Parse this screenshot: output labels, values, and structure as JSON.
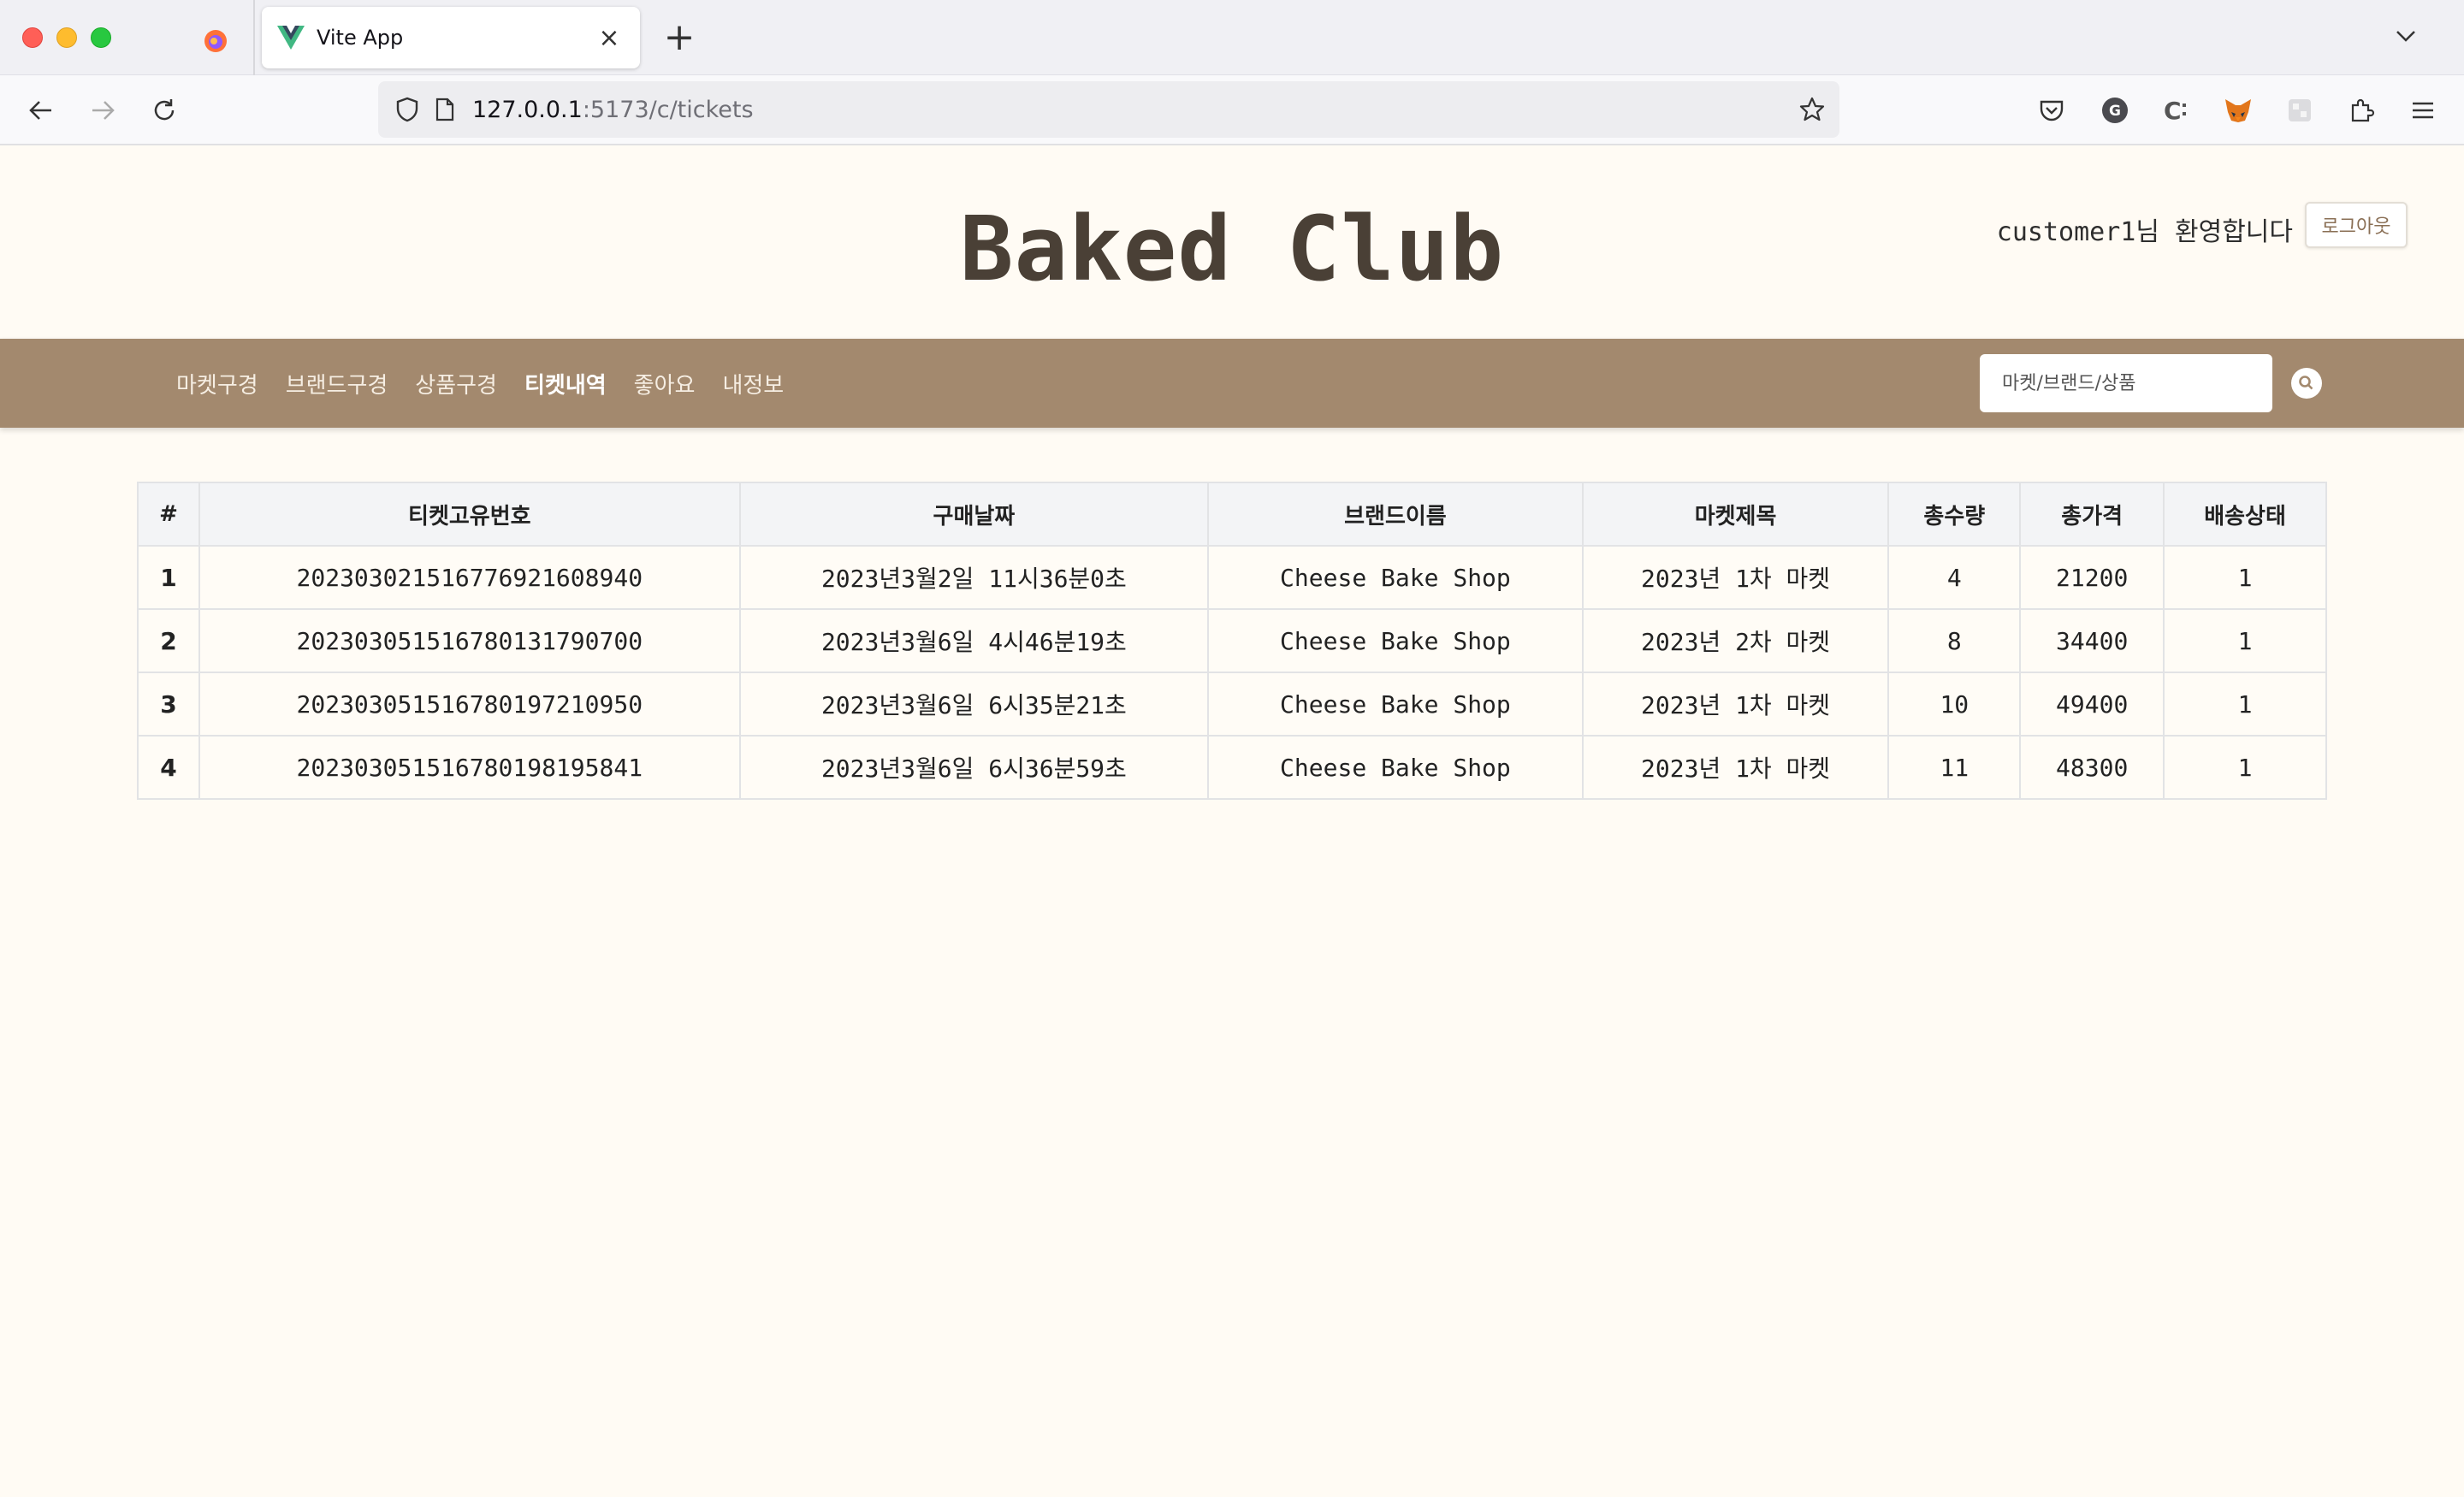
{
  "browser": {
    "tab_title": "Vite App",
    "url_host": "127.0.0.1",
    "url_path": ":5173/c/tickets"
  },
  "site": {
    "title": "Baked Club",
    "greeting": "customer1님 환영합니다",
    "logout_label": "로그아웃"
  },
  "nav": {
    "items": [
      {
        "label": "마켓구경"
      },
      {
        "label": "브랜드구경"
      },
      {
        "label": "상품구경"
      },
      {
        "label": "티켓내역",
        "active": true
      },
      {
        "label": "좋아요"
      },
      {
        "label": "내정보"
      }
    ]
  },
  "search": {
    "placeholder": "마켓/브랜드/상품"
  },
  "table": {
    "headers": [
      "#",
      "티켓고유번호",
      "구매날짜",
      "브랜드이름",
      "마켓제목",
      "총수량",
      "총가격",
      "배송상태"
    ],
    "rows": [
      [
        "1",
        "20230302151677692160894​0",
        "2023년3월2일 11시36분0초",
        "Cheese Bake Shop",
        "2023년 1차 마켓",
        "4",
        "21200",
        "1"
      ],
      [
        "2",
        "20230305151678013179070​0",
        "2023년3월6일 4시46분19초",
        "Cheese Bake Shop",
        "2023년 2차 마켓",
        "8",
        "34400",
        "1"
      ],
      [
        "3",
        "20230305151678019721095​0",
        "2023년3월6일 6시35분21초",
        "Cheese Bake Shop",
        "2023년 1차 마켓",
        "10",
        "49400",
        "1"
      ],
      [
        "4",
        "20230305151678019819584​1",
        "2023년3월6일 6시36분59초",
        "Cheese Bake Shop",
        "2023년 1차 마켓",
        "11",
        "48300",
        "1"
      ]
    ]
  },
  "colors": {
    "menu_bg": "#a3896e",
    "page_bg": "#fffbf4",
    "title_color": "#4a4036"
  }
}
